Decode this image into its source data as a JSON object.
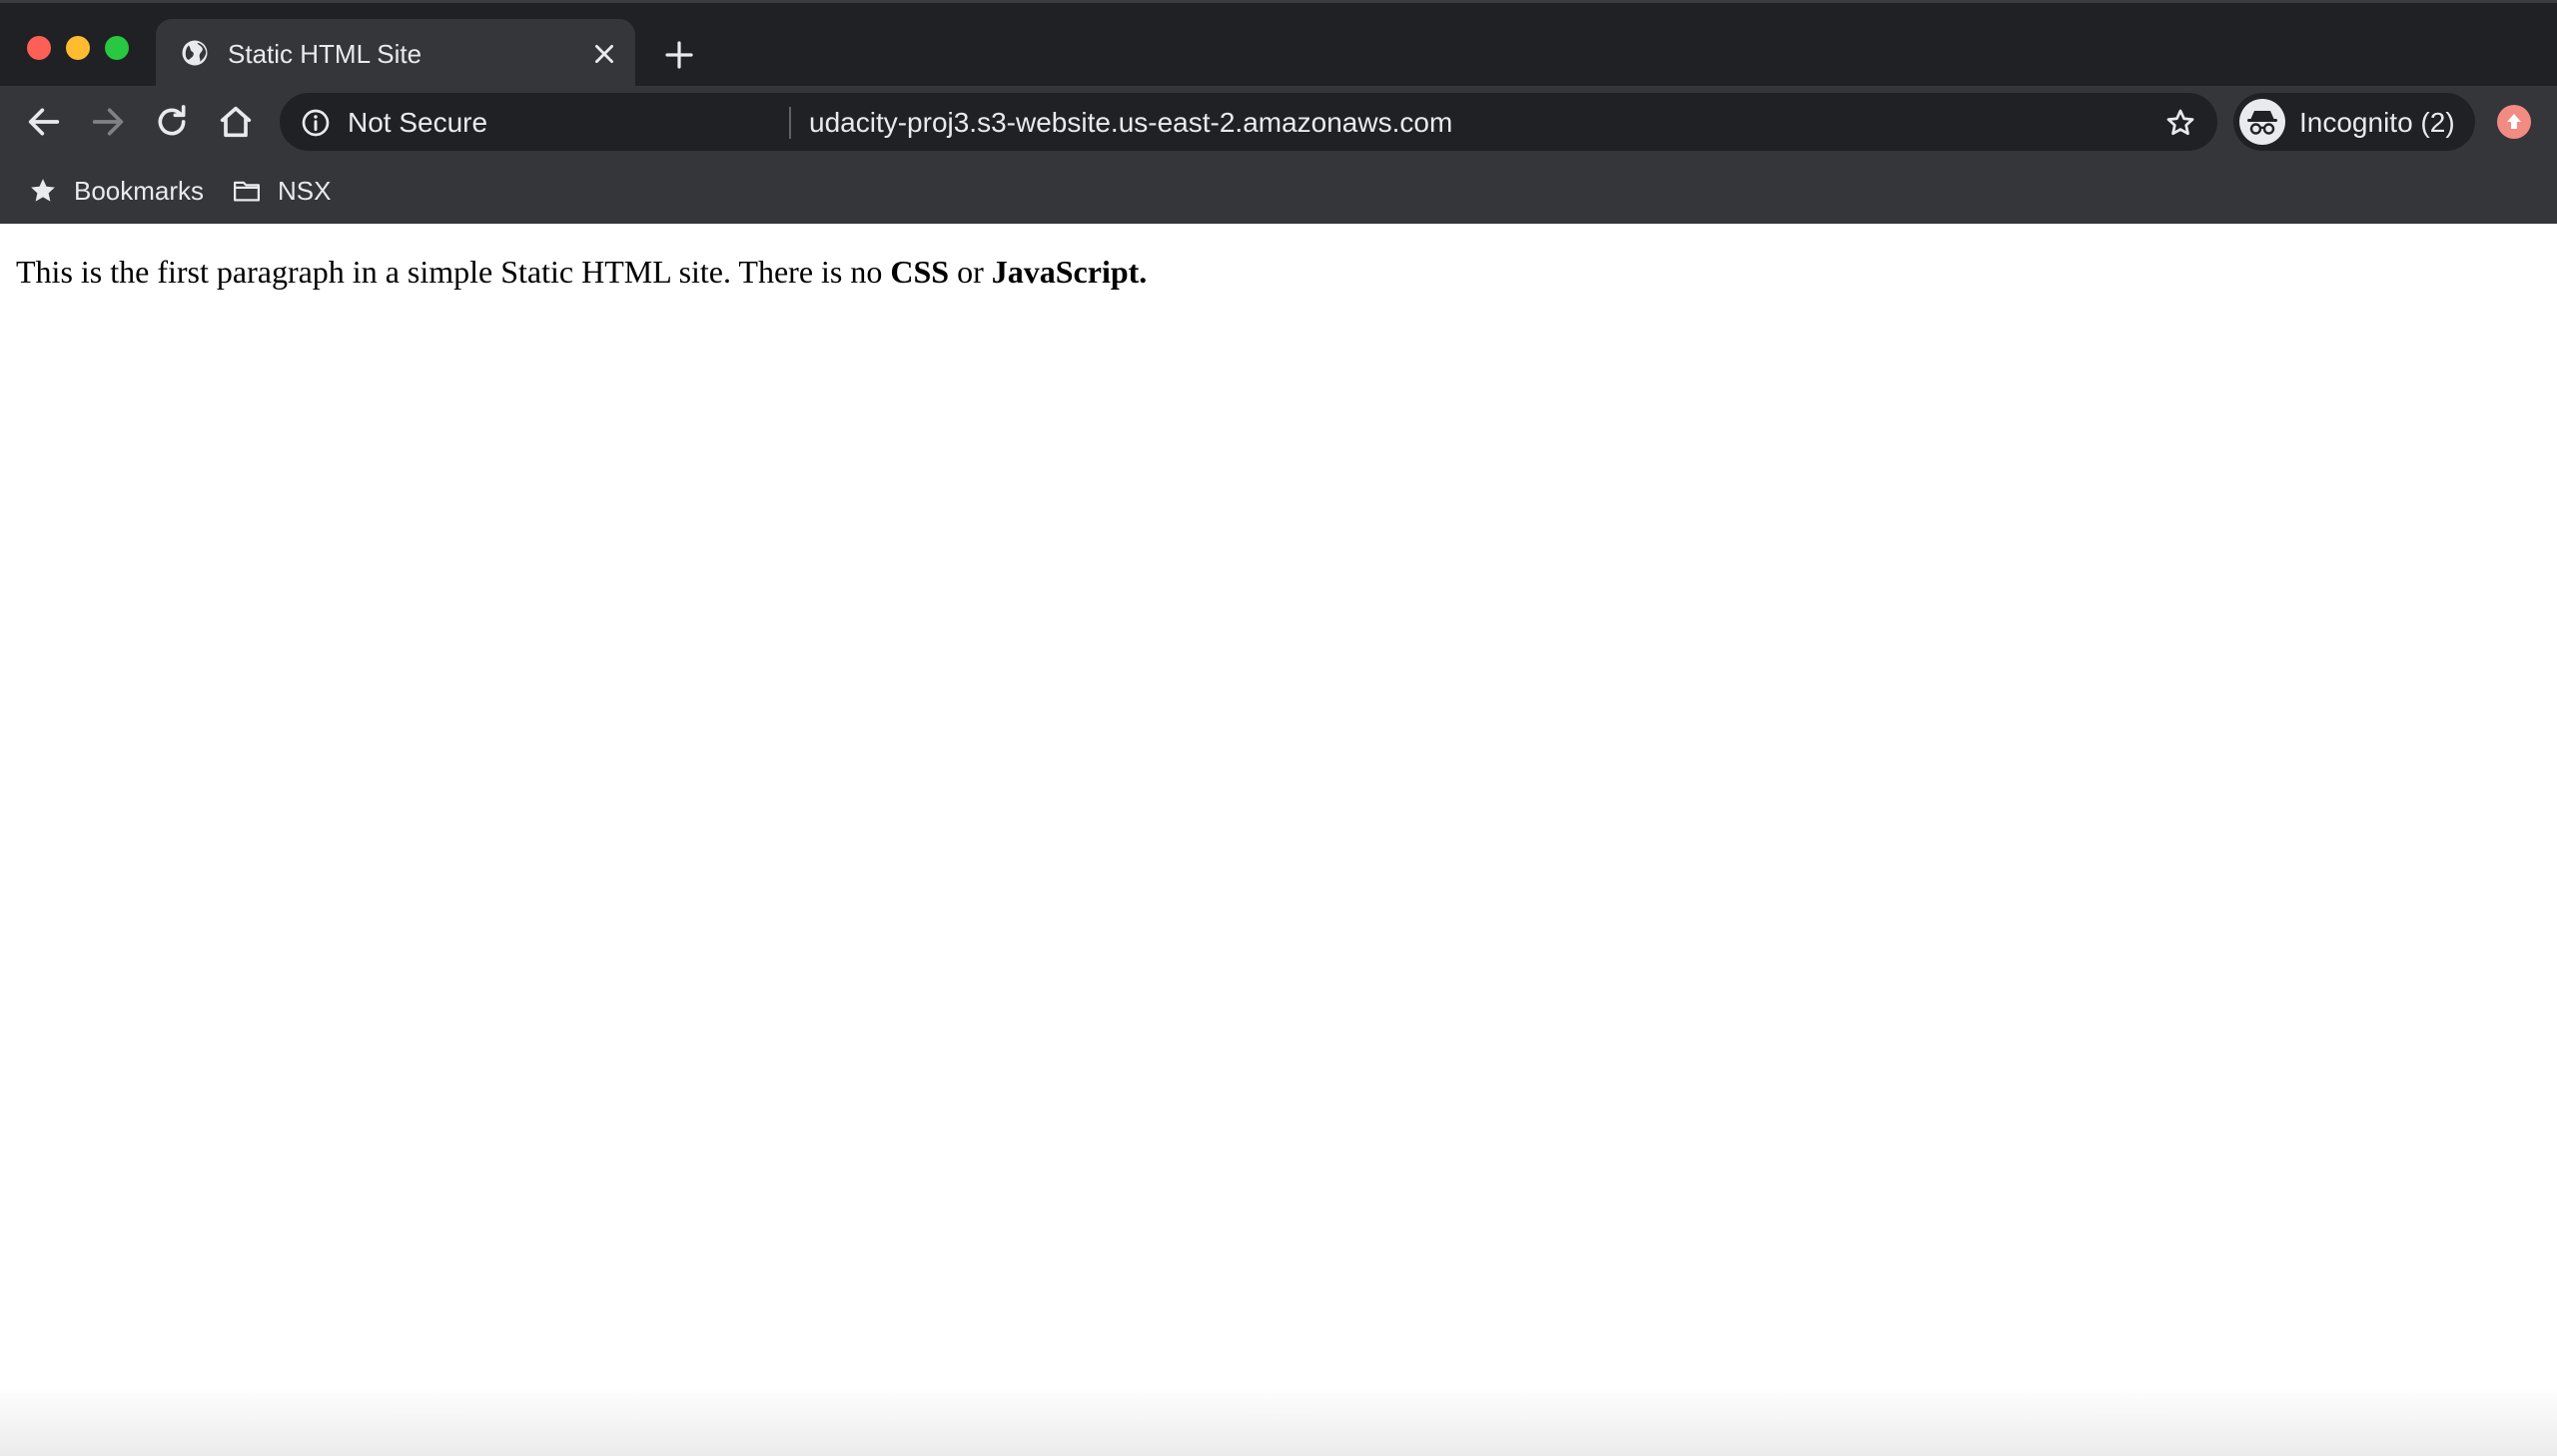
{
  "colors": {
    "tabstrip_bg": "#202124",
    "toolbar_bg": "#35363a",
    "omnibox_bg": "#202124",
    "text_light": "#e8eaed",
    "traffic_close": "#fe5f57",
    "traffic_minimize": "#febc2e",
    "traffic_maximize": "#28c840",
    "extension_badge": "#f28b82"
  },
  "window_controls": [
    "close",
    "minimize",
    "maximize"
  ],
  "tabs": [
    {
      "title": "Static HTML Site",
      "favicon": "globe-icon",
      "active": true
    }
  ],
  "toolbar": {
    "back_icon": "back-arrow-icon",
    "forward_icon": "forward-arrow-icon",
    "reload_icon": "reload-icon",
    "home_icon": "home-icon",
    "omnibox": {
      "security_label": "Not Secure",
      "url": "udacity-proj3.s3-website.us-east-2.amazonaws.com",
      "bookmark_icon": "star-outline-icon"
    },
    "profile": {
      "label": "Incognito (2)",
      "icon": "incognito-icon"
    },
    "extension_icon": "update-arrow-icon"
  },
  "bookmarks_bar": {
    "items": [
      {
        "label": "Bookmarks",
        "icon": "star-icon"
      },
      {
        "label": "NSX",
        "icon": "folder-icon"
      }
    ]
  },
  "page": {
    "paragraph_text": "This is the first paragraph in a simple Static HTML site. There is no ",
    "bold_css": "CSS",
    "connector": " or ",
    "bold_js": "JavaScript."
  }
}
